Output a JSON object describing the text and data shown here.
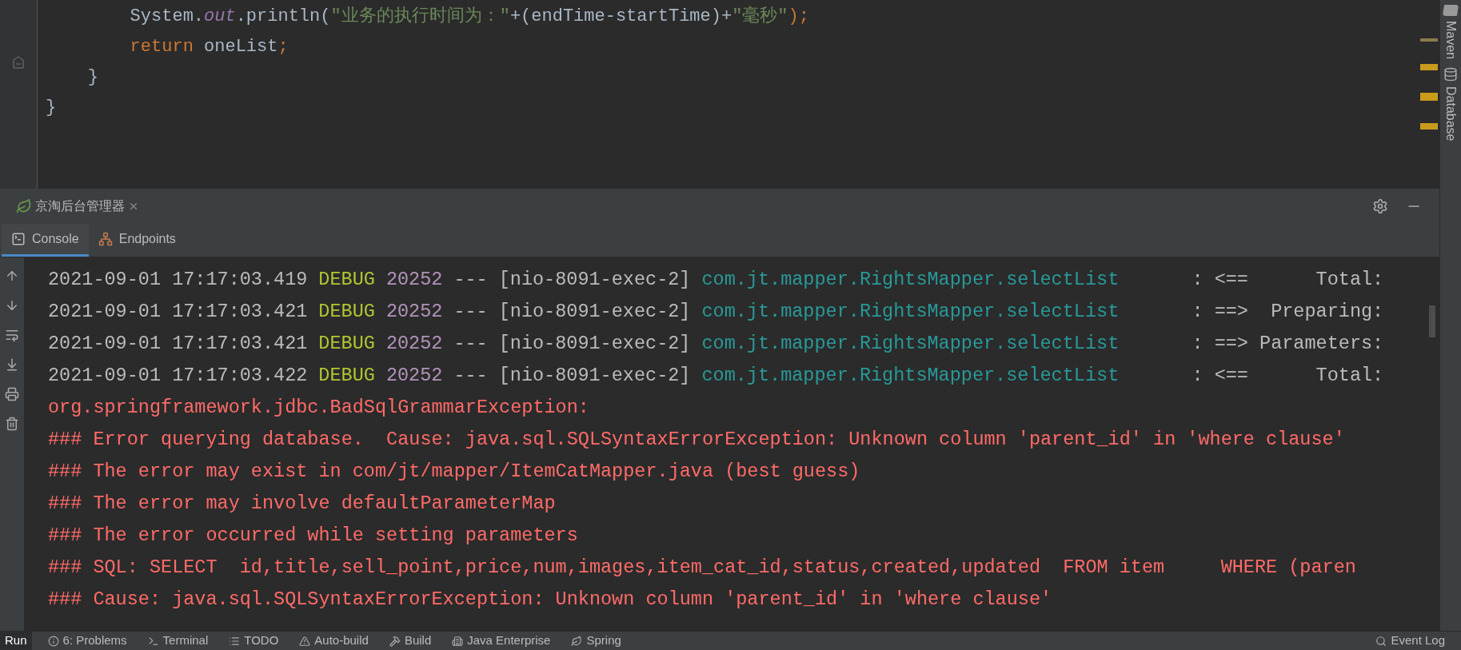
{
  "editor": {
    "lines": [
      {
        "tokens": [
          {
            "text": "        System.",
            "kind": "plain"
          },
          {
            "text": "out",
            "kind": "static"
          },
          {
            "text": ".println(",
            "kind": "plain"
          },
          {
            "text": "\"业务的执行时间为：\"",
            "kind": "string"
          },
          {
            "text": "+(endTime-startTime)+",
            "kind": "plain"
          },
          {
            "text": "\"毫秒\"",
            "kind": "string"
          },
          {
            "text": ");",
            "kind": "keyword"
          }
        ]
      },
      {
        "tokens": [
          {
            "text": "        return",
            "kind": "keyword"
          },
          {
            "text": " oneList",
            "kind": "plain"
          },
          {
            "text": ";",
            "kind": "keyword"
          }
        ]
      },
      {
        "tokens": [
          {
            "text": "    }",
            "kind": "plain"
          }
        ]
      },
      {
        "tokens": [
          {
            "text": "}",
            "kind": "plain"
          }
        ]
      }
    ]
  },
  "right_tools": [
    {
      "label": "Maven"
    },
    {
      "label": "Database"
    }
  ],
  "run_panel": {
    "title": "京淘后台管理器",
    "tabs": [
      {
        "label": "Console",
        "selected": true
      },
      {
        "label": "Endpoints",
        "selected": false
      }
    ],
    "console": [
      {
        "kind": "debug",
        "time": "2021-09-01 17:17:03.419",
        "level": "DEBUG",
        "pid": "20252",
        "separator": "---",
        "thread": "[nio-8091-exec-2]",
        "logger": "com.jt.mapper.RightsMapper.selectList",
        "message": ": <==      Total:"
      },
      {
        "kind": "debug",
        "time": "2021-09-01 17:17:03.421",
        "level": "DEBUG",
        "pid": "20252",
        "separator": "---",
        "thread": "[nio-8091-exec-2]",
        "logger": "com.jt.mapper.RightsMapper.selectList",
        "message": ": ==>  Preparing:"
      },
      {
        "kind": "debug",
        "time": "2021-09-01 17:17:03.421",
        "level": "DEBUG",
        "pid": "20252",
        "separator": "---",
        "thread": "[nio-8091-exec-2]",
        "logger": "com.jt.mapper.RightsMapper.selectList",
        "message": ": ==> Parameters:"
      },
      {
        "kind": "debug",
        "time": "2021-09-01 17:17:03.422",
        "level": "DEBUG",
        "pid": "20252",
        "separator": "---",
        "thread": "[nio-8091-exec-2]",
        "logger": "com.jt.mapper.RightsMapper.selectList",
        "message": ": <==      Total:"
      },
      {
        "kind": "error",
        "text": "org.springframework.jdbc.BadSqlGrammarException:"
      },
      {
        "kind": "error",
        "text": "### Error querying database.  Cause: java.sql.SQLSyntaxErrorException: Unknown column 'parent_id' in 'where clause'"
      },
      {
        "kind": "error",
        "text": "### The error may exist in com/jt/mapper/ItemCatMapper.java (best guess)"
      },
      {
        "kind": "error",
        "text": "### The error may involve defaultParameterMap"
      },
      {
        "kind": "error",
        "text": "### The error occurred while setting parameters"
      },
      {
        "kind": "error",
        "text": "### SQL: SELECT  id,title,sell_point,price,num,images,item_cat_id,status,created,updated  FROM item     WHERE (paren"
      },
      {
        "kind": "error",
        "text": "### Cause: java.sql.SQLSyntaxErrorException: Unknown column 'parent_id' in 'where clause'"
      }
    ]
  },
  "status_bar": [
    {
      "label": "Run",
      "selected": true
    },
    {
      "label": "6: Problems",
      "selected": false
    },
    {
      "label": "Terminal",
      "selected": false
    },
    {
      "label": "TODO",
      "selected": false
    },
    {
      "label": "Auto-build",
      "selected": false
    },
    {
      "label": "Build",
      "selected": false
    },
    {
      "label": "Java Enterprise",
      "selected": false
    },
    {
      "label": "Spring",
      "selected": false
    },
    {
      "label": "Event Log",
      "selected": false
    }
  ]
}
